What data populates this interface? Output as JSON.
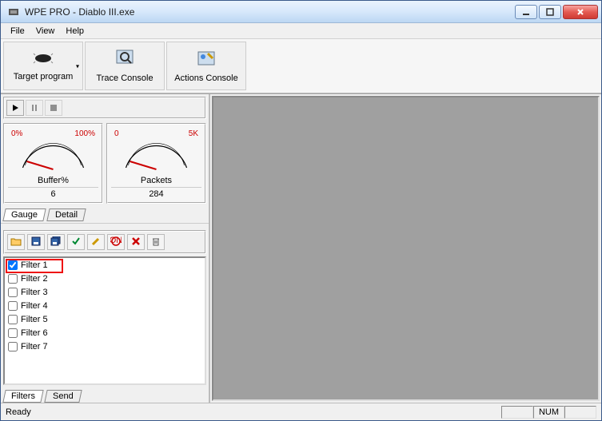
{
  "window": {
    "title": "WPE PRO - Diablo III.exe"
  },
  "menu": {
    "file": "File",
    "view": "View",
    "help": "Help"
  },
  "toolbar": {
    "target": "Target program",
    "trace": "Trace Console",
    "actions": "Actions Console"
  },
  "gauges": {
    "buffer": {
      "low": "0%",
      "high": "100%",
      "label": "Buffer%",
      "value": "6"
    },
    "packets": {
      "low": "0",
      "high": "5K",
      "label": "Packets",
      "value": "284"
    }
  },
  "gauge_tabs": {
    "gauge": "Gauge",
    "detail": "Detail"
  },
  "filters": {
    "items": [
      {
        "label": "Filter 1",
        "checked": true
      },
      {
        "label": "Filter 2",
        "checked": false
      },
      {
        "label": "Filter 3",
        "checked": false
      },
      {
        "label": "Filter 4",
        "checked": false
      },
      {
        "label": "Filter 5",
        "checked": false
      },
      {
        "label": "Filter 6",
        "checked": false
      },
      {
        "label": "Filter 7",
        "checked": false
      }
    ]
  },
  "filter_tabs": {
    "filters": "Filters",
    "send": "Send"
  },
  "status": {
    "ready": "Ready",
    "num": "NUM"
  }
}
